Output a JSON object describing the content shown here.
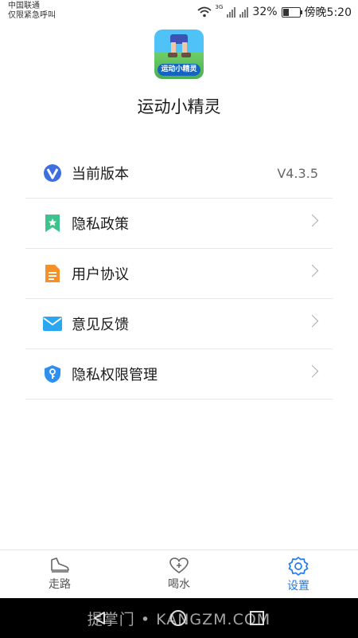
{
  "status_bar": {
    "carrier": "中国联通",
    "emergency": "仅限紧急呼叫",
    "network": "3G",
    "battery": "32%",
    "battery_level": 0.32,
    "time": "傍晚5:20"
  },
  "app": {
    "icon_label": "运动小精灵",
    "name": "运动小精灵"
  },
  "settings": {
    "items": [
      {
        "label": "当前版本",
        "value": "V4.3.5",
        "icon": "version-v-icon"
      },
      {
        "label": "隐私政策",
        "icon": "bookmark-star-icon"
      },
      {
        "label": "用户协议",
        "icon": "document-icon"
      },
      {
        "label": "意见反馈",
        "icon": "mail-icon"
      },
      {
        "label": "隐私权限管理",
        "icon": "shield-key-icon"
      }
    ]
  },
  "tabs": [
    {
      "label": "走路",
      "icon": "shoe-icon",
      "active": false
    },
    {
      "label": "喝水",
      "icon": "heart-plus-icon",
      "active": false
    },
    {
      "label": "设置",
      "icon": "gear-icon",
      "active": true
    }
  ],
  "colors": {
    "accent": "#1e7bf0",
    "tab_inactive": "#555555",
    "divider": "#e8e8e8"
  },
  "watermark": "提掌门 • KANGZM.COM"
}
